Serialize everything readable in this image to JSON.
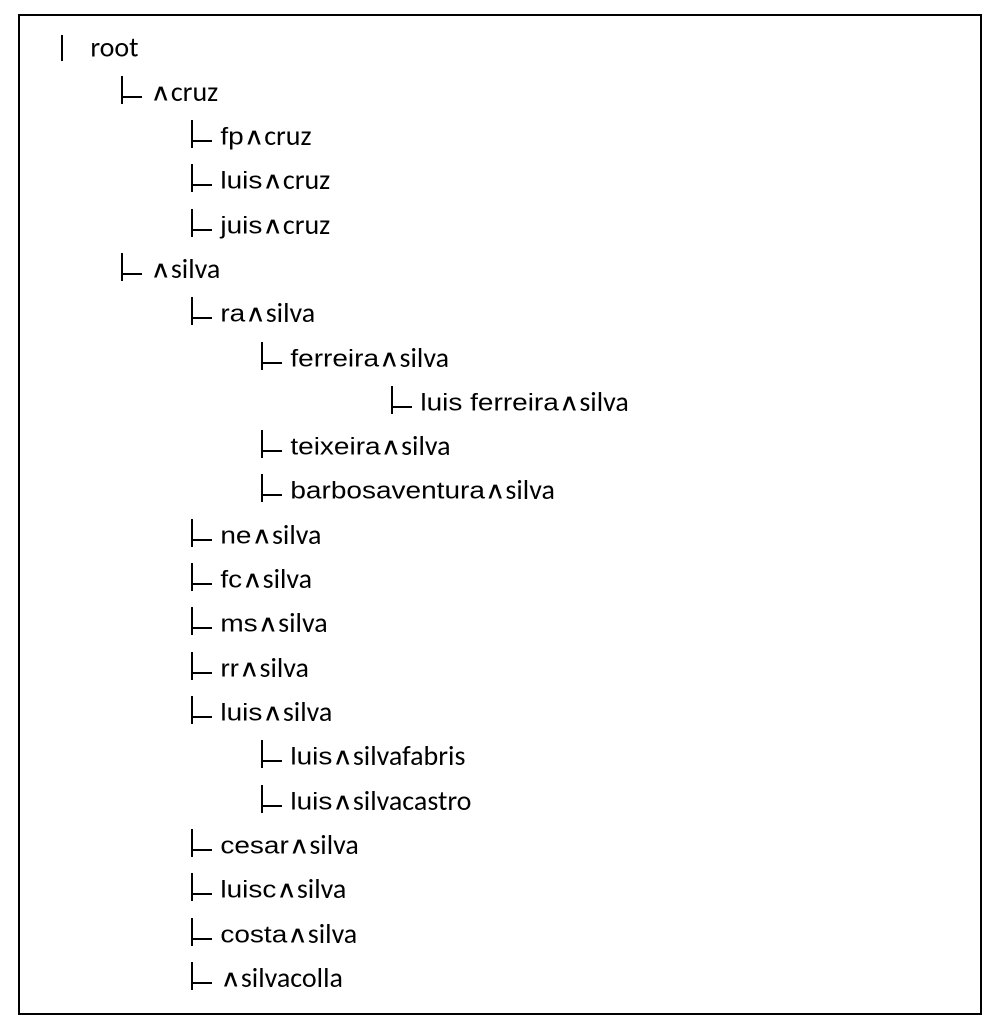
{
  "wedge": "∧",
  "tree": {
    "root": "root",
    "nodes": [
      {
        "indent": 0,
        "label": "root",
        "root": true
      },
      {
        "indent": 1,
        "pre": "∧ ",
        "label": "cruz"
      },
      {
        "indent": 2,
        "pre": "fp∧ ",
        "label": "cruz"
      },
      {
        "indent": 2,
        "pre": "luis∧ ",
        "label": "cruz"
      },
      {
        "indent": 2,
        "pre": "juis∧ ",
        "label": "cruz"
      },
      {
        "indent": 1,
        "pre": "∧",
        "label": "silva"
      },
      {
        "indent": 2,
        "pre": "ra∧ ",
        "label": "silva"
      },
      {
        "indent": 3,
        "pre": "ferreira∧ ",
        "label": "silva"
      },
      {
        "indent": 4,
        "pre": "luis ferreira∧ ",
        "label": "silva"
      },
      {
        "indent": 3,
        "pre": "teixeira∧ ",
        "label": "silva"
      },
      {
        "indent": 3,
        "pre": "barbosaventura∧ ",
        "label": "silva"
      },
      {
        "indent": 2,
        "pre": "ne∧ ",
        "label": "silva"
      },
      {
        "indent": 2,
        "pre": "fc∧ ",
        "label": "silva"
      },
      {
        "indent": 2,
        "pre": "ms∧ ",
        "label": "silva"
      },
      {
        "indent": 2,
        "pre": "rr∧ ",
        "label": "silva"
      },
      {
        "indent": 2,
        "pre": "luis∧ ",
        "label": "silva"
      },
      {
        "indent": 3,
        "pre": "luis∧ ",
        "label": "silvafabris"
      },
      {
        "indent": 3,
        "pre": "luis∧ ",
        "label": "silvacastro"
      },
      {
        "indent": 2,
        "pre": "cesar∧ ",
        "label": "silva"
      },
      {
        "indent": 2,
        "pre": "luisc∧ ",
        "label": "silva"
      },
      {
        "indent": 2,
        "pre": "costa∧ ",
        "label": "silva"
      },
      {
        "indent": 2,
        "pre": "∧ ",
        "label": "silvacolla"
      }
    ]
  }
}
